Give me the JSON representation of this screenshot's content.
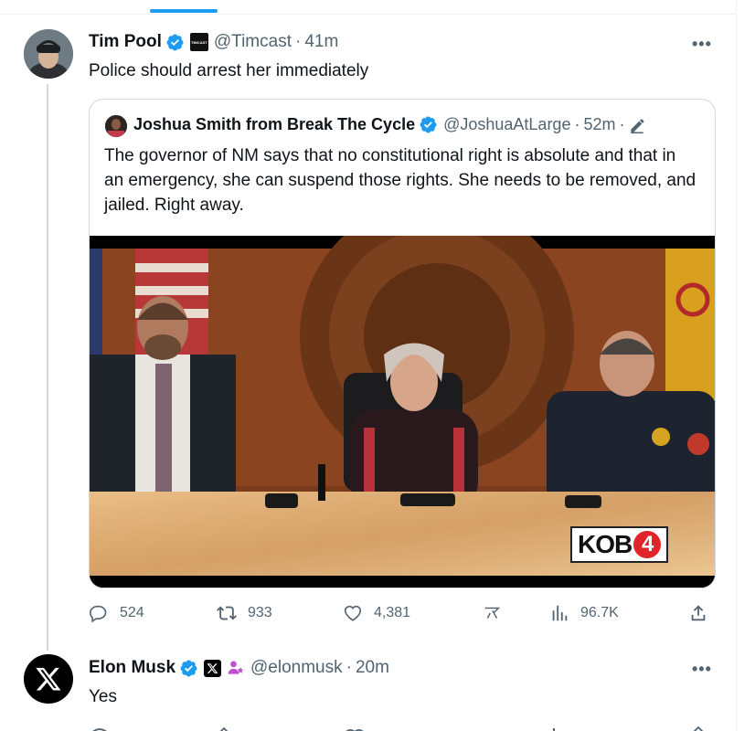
{
  "tweet": {
    "author_name": "Tim Pool",
    "author_handle": "@Timcast",
    "affiliate_badge_text": "TIMCAST",
    "separator": "·",
    "time": "41m",
    "text": "Police should arrest her immediately",
    "more": "•••"
  },
  "quoted": {
    "author_name": "Joshua Smith from Break The Cycle",
    "author_handle": "@JoshuaAtLarge",
    "separator": "·",
    "time": "52m",
    "separator2": "·",
    "text": "The governor of NM says that no constitutional right is absolute and that in an emergency, she can suspend those rights. She needs to be removed, and jailed. Right away.",
    "video": {
      "station_logo": "KOB",
      "station_number": "4"
    }
  },
  "actions": {
    "replies": "524",
    "reposts": "933",
    "likes": "4,381",
    "views": "96.7K"
  },
  "reply": {
    "author_name": "Elon Musk",
    "author_handle": "@elonmusk",
    "separator": "·",
    "time": "20m",
    "text": "Yes",
    "more": "•••"
  },
  "colors": {
    "verified": "#1d9bf0",
    "text_primary": "#0f1419",
    "text_secondary": "#536471",
    "border": "#cfd9de",
    "accent_tab": "#1d9bf0",
    "kob_red": "#e0242a"
  },
  "icons": [
    "verified-icon",
    "more-icon",
    "edit-pencil-icon",
    "reply-icon",
    "repost-icon",
    "like-icon",
    "grok-icon",
    "views-icon",
    "share-icon",
    "x-logo-icon",
    "subscriber-badge-icon"
  ]
}
